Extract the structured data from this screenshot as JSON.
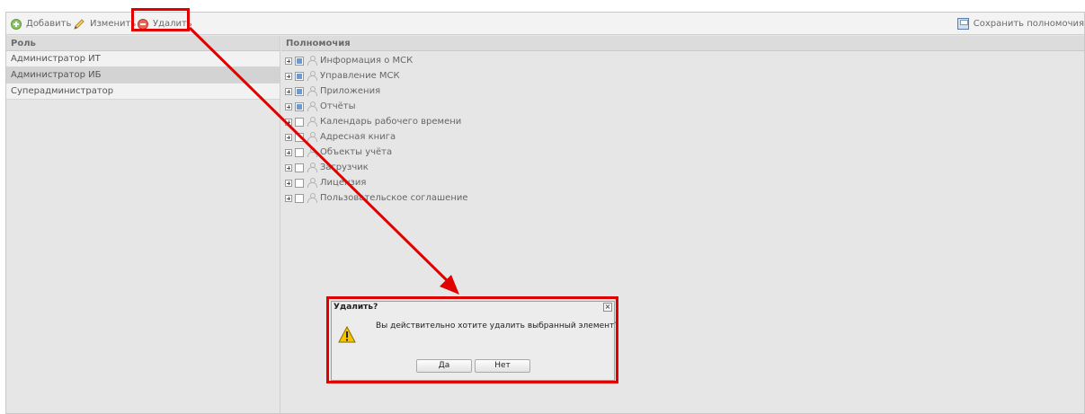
{
  "toolbar": {
    "add_label": "Добавить",
    "edit_label": "Изменить",
    "delete_label": "Удалить",
    "save_label": "Сохранить полномочия"
  },
  "roles": {
    "header": "Роль",
    "items": [
      {
        "label": "Администратор ИТ"
      },
      {
        "label": "Администратор ИБ"
      },
      {
        "label": "Суперадминистратор"
      }
    ]
  },
  "permissions": {
    "header": "Полномочия",
    "items": [
      {
        "label": "Информация о МСК",
        "checked": true
      },
      {
        "label": "Управление МСК",
        "checked": true
      },
      {
        "label": "Приложения",
        "checked": true
      },
      {
        "label": "Отчёты",
        "checked": true
      },
      {
        "label": "Календарь рабочего времени",
        "checked": false
      },
      {
        "label": "Адресная книга",
        "checked": false
      },
      {
        "label": "Объекты учёта",
        "checked": false
      },
      {
        "label": "Загрузчик",
        "checked": false
      },
      {
        "label": "Лицензия",
        "checked": false
      },
      {
        "label": "Пользовательское соглашение",
        "checked": false
      }
    ]
  },
  "dialog": {
    "title": "Удалить?",
    "close": "×",
    "message": "Вы действительно хотите удалить выбранный элемент?",
    "yes_label": "Да",
    "no_label": "Нет"
  },
  "colors": {
    "highlight": "#e00000",
    "warning": "#f5c400",
    "checked": "#6c9bd1"
  },
  "icons": {
    "add": "add-circle-icon",
    "edit": "pencil-icon",
    "delete": "delete-circle-icon",
    "save": "floppy-disk-icon",
    "warning": "warning-icon"
  }
}
